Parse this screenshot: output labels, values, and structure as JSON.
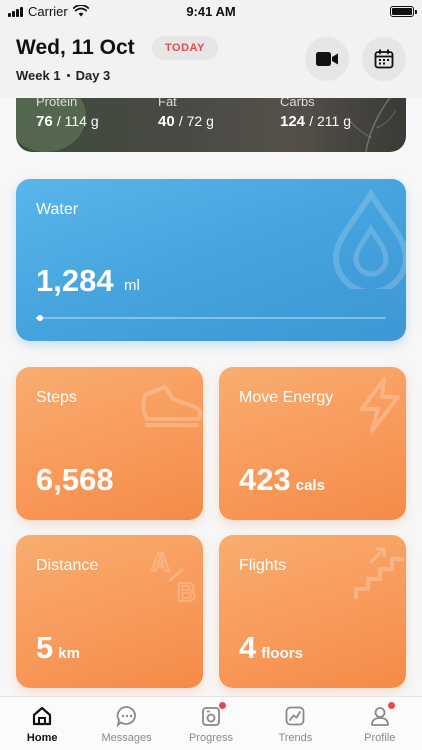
{
  "status_bar": {
    "carrier": "Carrier",
    "time": "9:41 AM"
  },
  "header": {
    "date": "Wed, 11 Oct",
    "today_badge": "TODAY",
    "week": "Week 1",
    "day": "Day 3",
    "video_icon": "video-camera-icon",
    "calendar_icon": "calendar-icon"
  },
  "macros": [
    {
      "name": "Protein",
      "value": "76",
      "target": "/ 114 g"
    },
    {
      "name": "Fat",
      "value": "40",
      "target": "/ 72 g"
    },
    {
      "name": "Carbs",
      "value": "124",
      "target": "/ 211 g"
    }
  ],
  "water": {
    "title": "Water",
    "value": "1,284",
    "unit": "ml",
    "progress": 0.01
  },
  "tiles": {
    "steps": {
      "title": "Steps",
      "value": "6,568",
      "unit": ""
    },
    "move_energy": {
      "title": "Move Energy",
      "value": "423",
      "unit": "cals"
    },
    "distance": {
      "title": "Distance",
      "value": "5",
      "unit": "km"
    },
    "flights": {
      "title": "Flights",
      "value": "4",
      "unit": "floors"
    }
  },
  "tabs": [
    {
      "label": "Home",
      "icon": "home-icon",
      "active": true,
      "badge": false
    },
    {
      "label": "Messages",
      "icon": "chat-bubble-icon",
      "active": false,
      "badge": false
    },
    {
      "label": "Progress",
      "icon": "camera-icon",
      "active": false,
      "badge": true
    },
    {
      "label": "Trends",
      "icon": "trend-chart-icon",
      "active": false,
      "badge": false
    },
    {
      "label": "Profile",
      "icon": "user-icon",
      "active": false,
      "badge": true
    }
  ],
  "colors": {
    "water_card": "#44a2dc",
    "tile_orange": "#f89a5b",
    "today_red": "#e5484d",
    "badge_red": "#e5484d"
  }
}
